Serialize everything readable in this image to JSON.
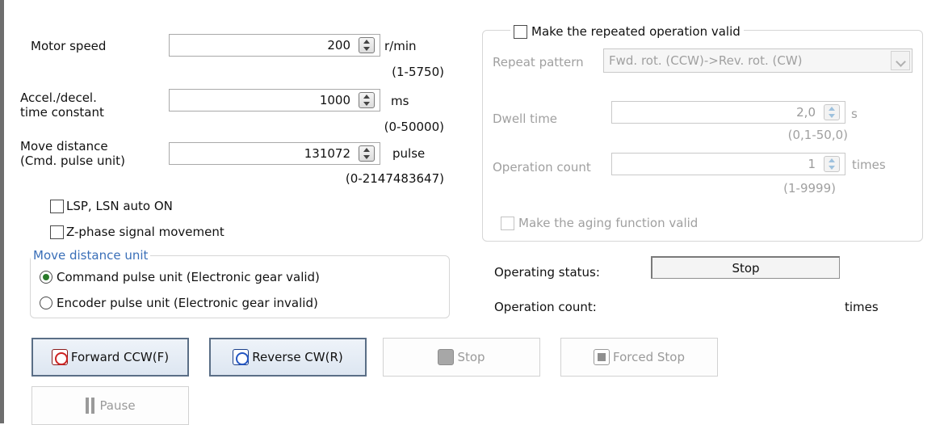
{
  "left_panel": {
    "motor_speed": {
      "label": "Motor speed",
      "value": "200",
      "unit": "r/min",
      "range": "(1-5750)"
    },
    "accel": {
      "label_line1": "Accel./decel.",
      "label_line2": "time constant",
      "value": "1000",
      "unit": "ms",
      "range": "(0-50000)"
    },
    "move_distance": {
      "label_line1": "Move distance",
      "label_line2": "(Cmd. pulse unit)",
      "value": "131072",
      "unit": "pulse",
      "range": "(0-2147483647)"
    },
    "lsp_checkbox": {
      "label": "LSP, LSN auto ON",
      "checked": false
    },
    "zphase_checkbox": {
      "label": "Z-phase signal movement",
      "checked": false
    },
    "unit_group": {
      "title": "Move distance unit",
      "options": [
        {
          "label": "Command pulse unit (Electronic gear valid)",
          "selected": true
        },
        {
          "label": "Encoder pulse unit (Electronic gear invalid)",
          "selected": false
        }
      ]
    }
  },
  "right_panel": {
    "repeat_checkbox": {
      "label": "Make the repeated operation valid",
      "checked": false
    },
    "repeat_pattern": {
      "label": "Repeat pattern",
      "value": "Fwd. rot. (CCW)->Rev. rot. (CW)"
    },
    "dwell_time": {
      "label": "Dwell time",
      "value": "2,0",
      "unit": "s",
      "range": "(0,1-50,0)"
    },
    "operation_count_field": {
      "label": "Operation count",
      "value": "1",
      "unit": "times",
      "range": "(1-9999)"
    },
    "aging_checkbox": {
      "label": "Make the aging function valid",
      "checked": false
    }
  },
  "status": {
    "operating_status_label": "Operating status:",
    "operating_status_value": "Stop",
    "operation_count_label": "Operation count:",
    "operation_count_unit": "times"
  },
  "buttons": {
    "forward": "Forward CCW(F)",
    "reverse": "Reverse CW(R)",
    "stop": "Stop",
    "forced_stop": "Forced Stop",
    "pause": "Pause"
  },
  "colors": {
    "group_title": "#3a6fb8",
    "disabled_text": "#a0a0a0",
    "radio_dot": "#2a7a2a"
  }
}
